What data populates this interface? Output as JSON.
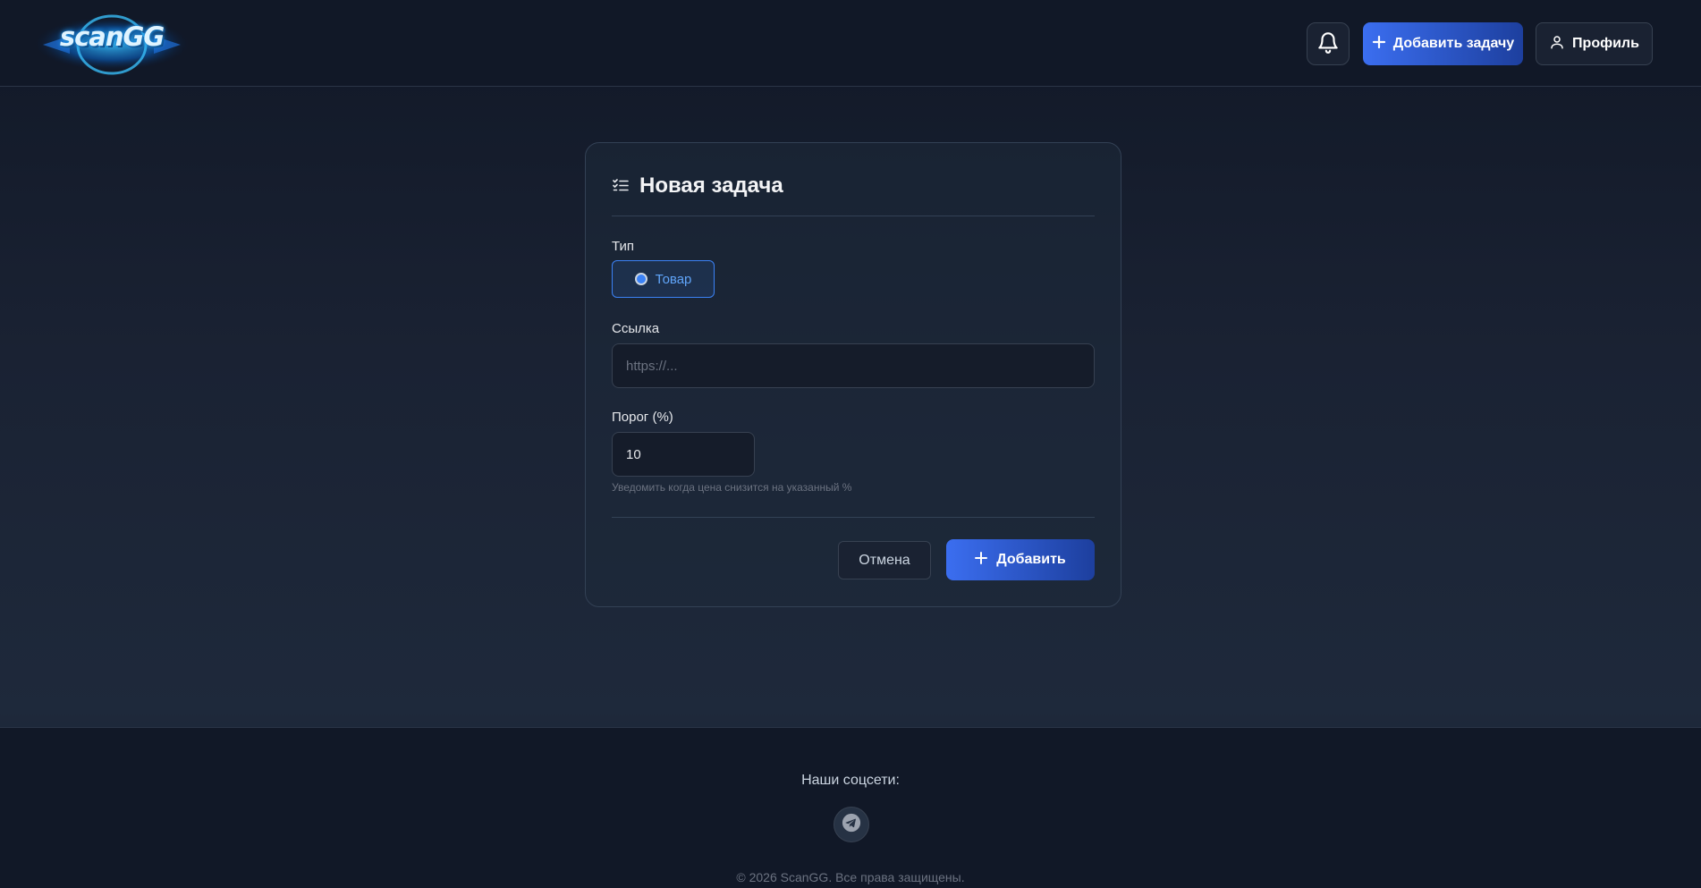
{
  "header": {
    "logo_text": "scanGG",
    "add_task_label": "Добавить задачу",
    "profile_label": "Профиль",
    "icons": {
      "bell": "bell-icon",
      "plus": "plus-icon",
      "user": "user-icon"
    }
  },
  "form": {
    "title": "Новая задача",
    "title_icon": "list-checks-icon",
    "type_label": "Тип",
    "type_options": [
      {
        "label": "Товар",
        "selected": true
      }
    ],
    "link_label": "Ссылка",
    "link_placeholder": "https://...",
    "link_value": "",
    "threshold_label": "Порог (%)",
    "threshold_value": "10",
    "threshold_hint": "Уведомить когда цена снизится на указанный %",
    "cancel_label": "Отмена",
    "submit_label": "Добавить"
  },
  "footer": {
    "social_label": "Наши соцсети:",
    "social_icons": [
      "telegram-icon"
    ],
    "copyright": "© 2026 ScanGG. Все права защищены."
  },
  "colors": {
    "accent": "#3b6ef0",
    "accent_dark": "#1d3f9e",
    "background": "#111827",
    "card_border": "#334155",
    "selected_option": "#60a5fa"
  }
}
